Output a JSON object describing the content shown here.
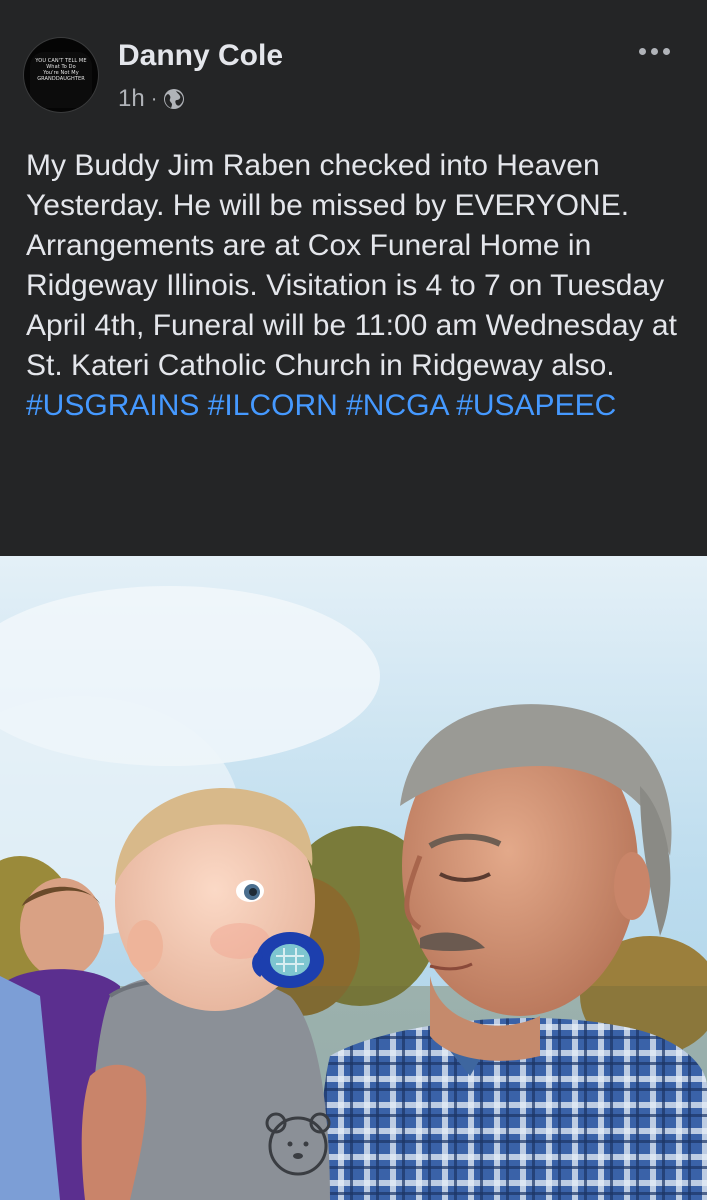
{
  "post": {
    "author": {
      "name": "Danny Cole",
      "avatar_text": [
        "YOU CAN'T TELL ME",
        "What To Do",
        "You're Not My",
        "GRANDDAUGHTER"
      ]
    },
    "timestamp": "1h",
    "separator": "·",
    "privacy_icon": "globe-icon",
    "more_icon": "more-horizontal-icon",
    "body_text": "My Buddy Jim Raben checked into Heaven Yesterday.  He will be missed by EVERYONE. Arrangements are at Cox Funeral Home in Ridgeway Illinois. Visitation is 4 to 7 on Tuesday April 4th, Funeral will be 11:00 am  Wednesday  at St. Kateri Catholic Church in Ridgeway also. ",
    "hashtags": [
      "#USGRAINS",
      "#ILCORN",
      "#NCGA",
      "#USAPEEC"
    ],
    "photo": {
      "subject": "older man in plaid shirt holding a baby with a blue pacifier outdoors"
    }
  },
  "colors": {
    "background": "#242526",
    "text_primary": "#e4e6eb",
    "text_secondary": "#b0b3b8",
    "hashtag": "#4599ff"
  }
}
